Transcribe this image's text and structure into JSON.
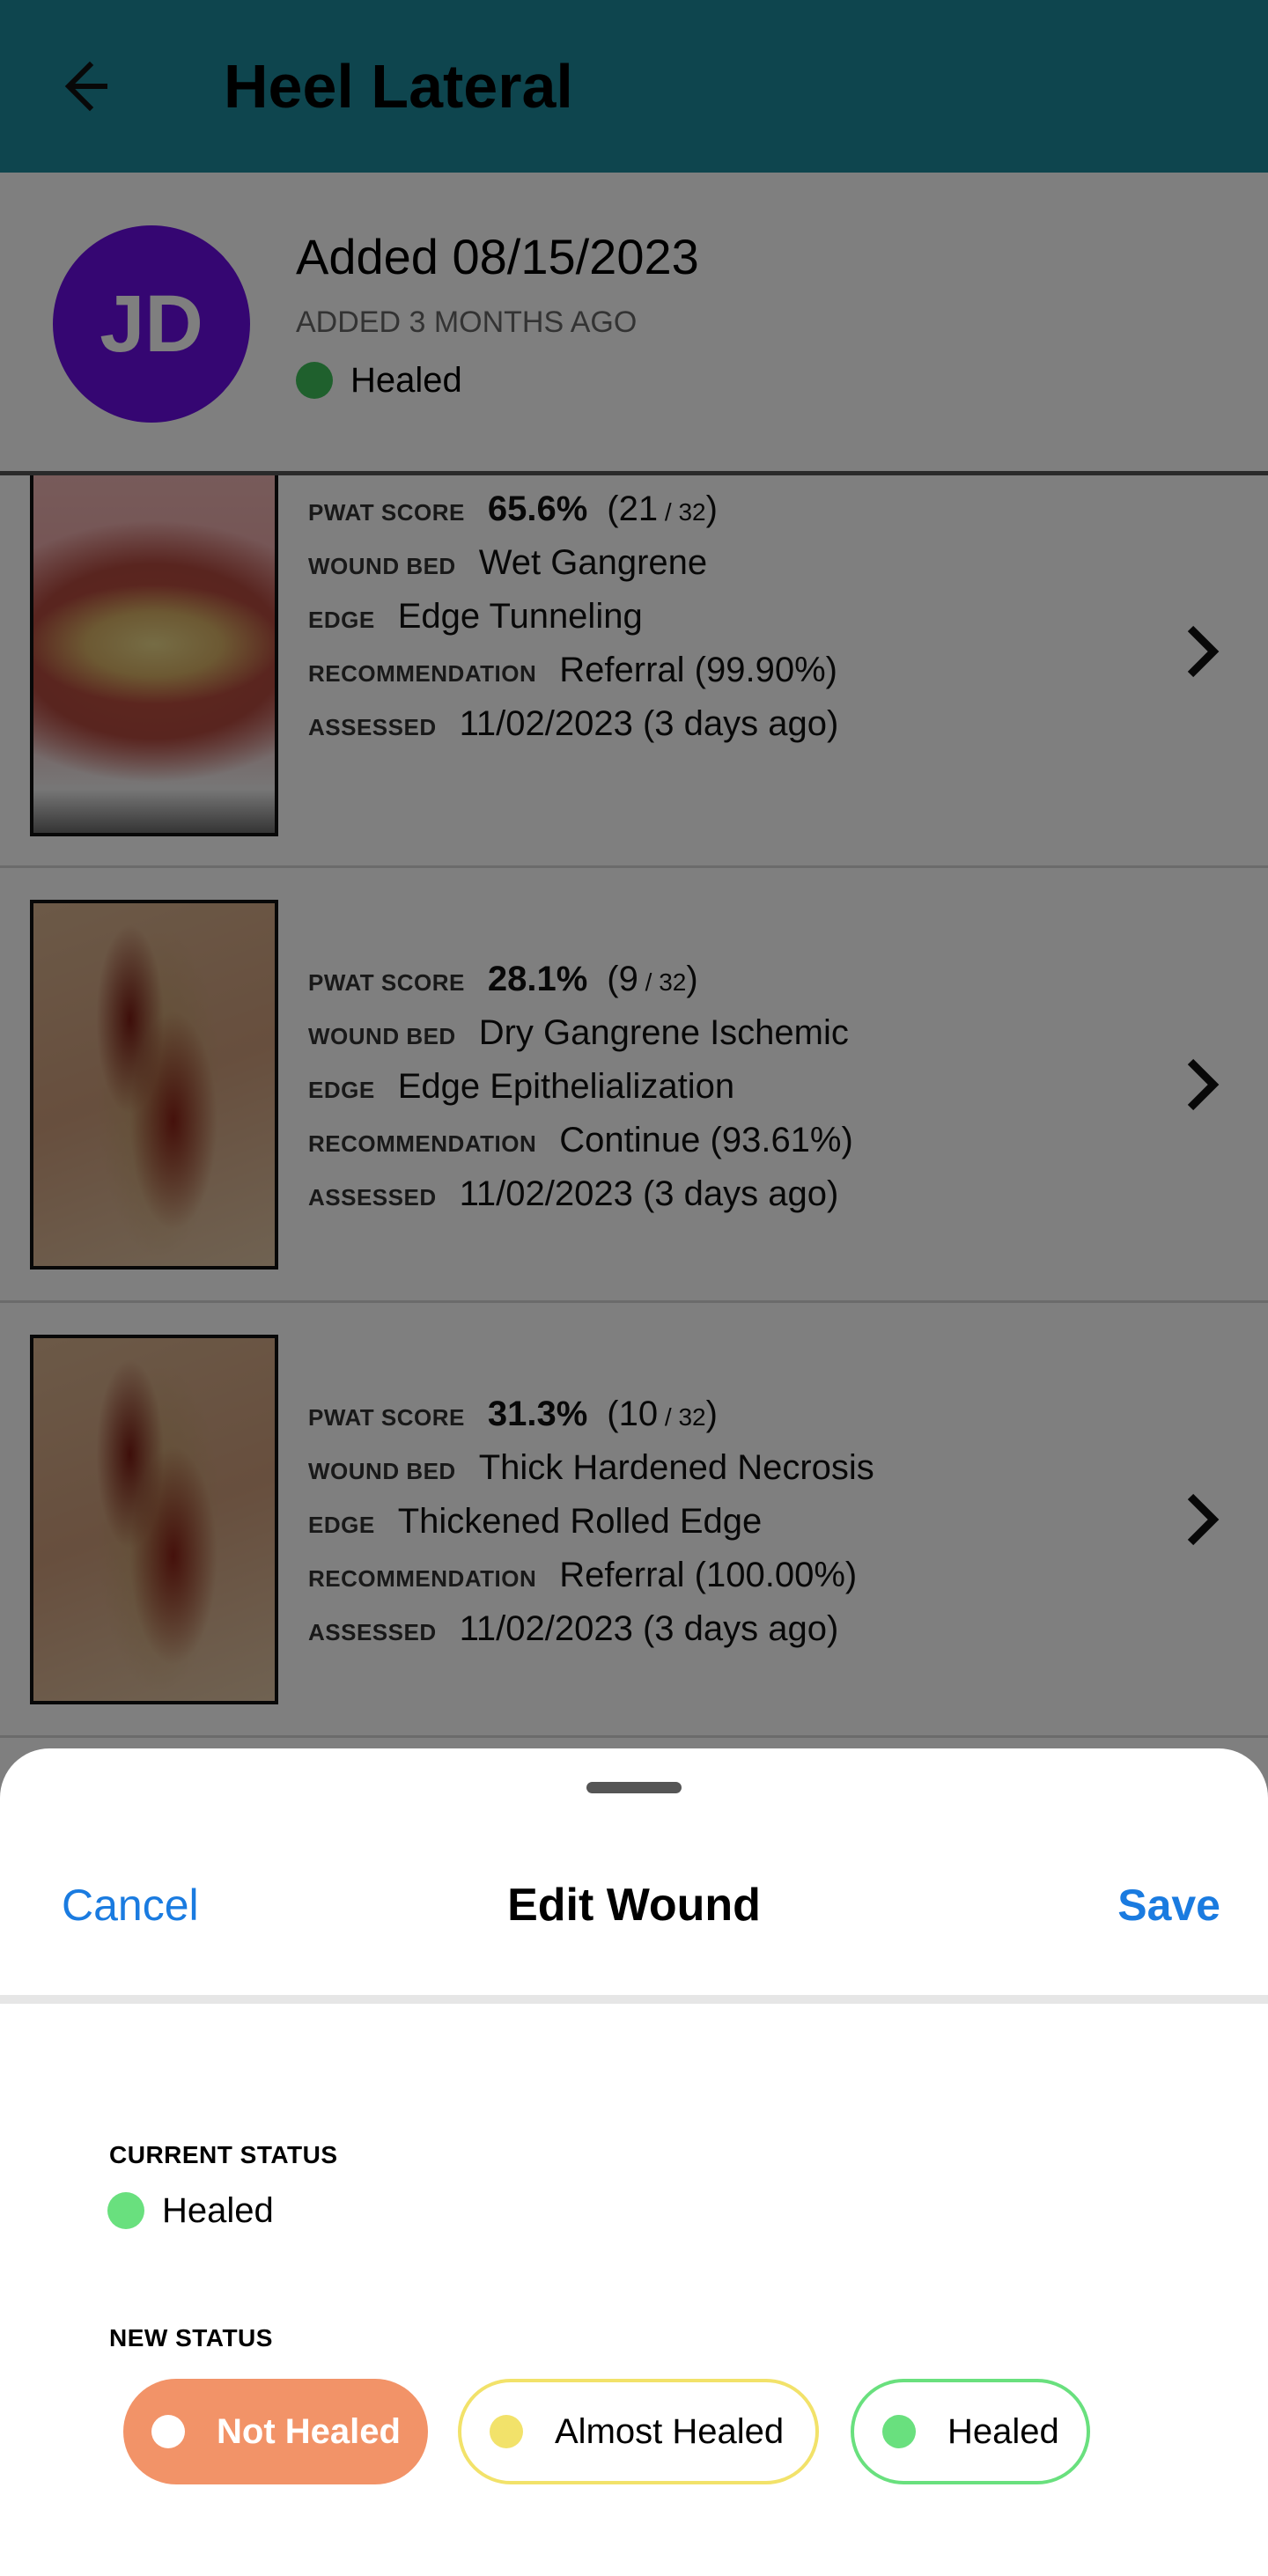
{
  "appbar": {
    "title": "Heel Lateral",
    "back_icon": "arrow-left-icon",
    "color": "#1d8a9d"
  },
  "header": {
    "avatar_initials": "JD",
    "avatar_color": "#6a0de5",
    "added_date": "Added 08/15/2023",
    "added_ago": "ADDED 3 MONTHS AGO",
    "status": "Healed",
    "status_color": "#3fc15a"
  },
  "labels": {
    "pwat": "PWAT SCORE",
    "wound_bed": "WOUND BED",
    "edge": "EDGE",
    "recommendation": "RECOMMENDATION",
    "assessed": "ASSESSED"
  },
  "assessments": [
    {
      "pwat_pct": "65.6%",
      "pwat_open": "(21",
      "pwat_sep": " / ",
      "pwat_total": "32",
      "pwat_close": ")",
      "wound_bed": "Wet Gangrene",
      "edge": "Edge Tunneling",
      "recommendation": "Referral (99.90%)",
      "assessed": "11/02/2023 (3 days ago)"
    },
    {
      "pwat_pct": "28.1%",
      "pwat_open": "(9",
      "pwat_sep": " / ",
      "pwat_total": "32",
      "pwat_close": ")",
      "wound_bed": "Dry Gangrene Ischemic",
      "edge": "Edge Epithelialization",
      "recommendation": "Continue (93.61%)",
      "assessed": "11/02/2023 (3 days ago)"
    },
    {
      "pwat_pct": "31.3%",
      "pwat_open": "(10",
      "pwat_sep": " / ",
      "pwat_total": "32",
      "pwat_close": ")",
      "wound_bed": "Thick Hardened Necrosis",
      "edge": "Thickened Rolled Edge",
      "recommendation": "Referral (100.00%)",
      "assessed": "11/02/2023 (3 days ago)"
    }
  ],
  "sheet": {
    "cancel": "Cancel",
    "title": "Edit Wound",
    "save": "Save",
    "accent_color": "#1a7be0",
    "current_status_label": "CURRENT STATUS",
    "current_status": "Healed",
    "new_status_label": "NEW STATUS",
    "options": [
      {
        "label": "Not Healed",
        "color": "#f29368",
        "selected": true
      },
      {
        "label": "Almost Healed",
        "color": "#f2e26a",
        "selected": false
      },
      {
        "label": "Healed",
        "color": "#69e07e",
        "selected": false
      }
    ]
  }
}
